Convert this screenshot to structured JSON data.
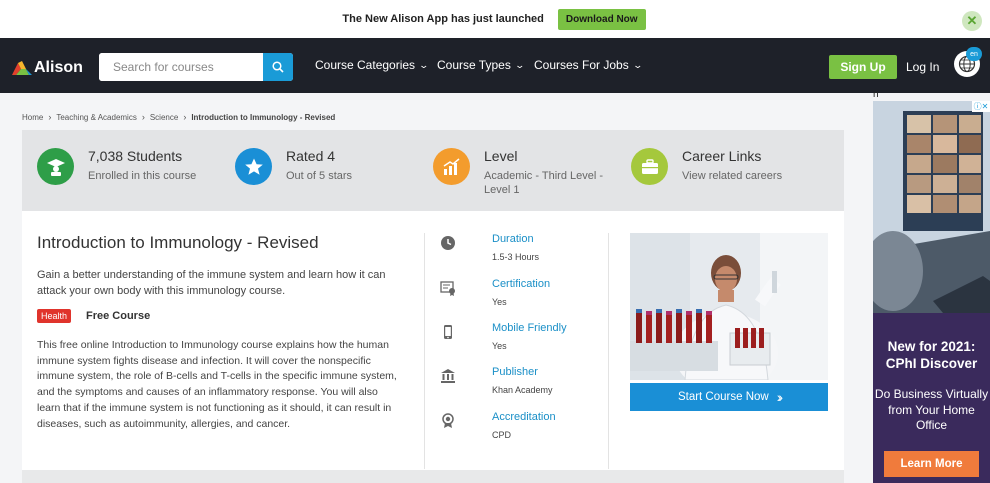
{
  "banner": {
    "text": "The New Alison App has just launched",
    "button": "Download Now"
  },
  "nav": {
    "logo": "Alison",
    "search_placeholder": "Search for courses",
    "links": [
      "Course Categories",
      "Course Types",
      "Courses For Jobs"
    ],
    "signup": "Sign Up",
    "login": "Log In",
    "lang": "en"
  },
  "breadcrumb": [
    "Home",
    "Teaching & Academics",
    "Science",
    "Introduction to Immunology - Revised"
  ],
  "stats": [
    {
      "title": "7,038 Students",
      "sub": "Enrolled in this course",
      "icon": "graduate-icon",
      "color": "#2e9e48"
    },
    {
      "title": "Rated 4",
      "sub": "Out of 5 stars",
      "icon": "star-icon",
      "color": "#1a8fd6"
    },
    {
      "title": "Level",
      "sub": "Academic - Third Level - Level 1",
      "icon": "level-chart-icon",
      "color": "#f39c2d"
    },
    {
      "title": "Career Links",
      "sub": "View related careers",
      "icon": "briefcase-icon",
      "color": "#a5c83c"
    }
  ],
  "course": {
    "title": "Introduction to Immunology - Revised",
    "subtitle": "Gain a better understanding of the immune system and learn how it can attack your own body with this immunology course.",
    "tag": "Health",
    "price": "Free Course",
    "description": "This free online Introduction to Immunology course explains how the human immune system fights disease and infection. It will cover the nonspecific immune system, the role of B-cells and T-cells in the specific immune system, and the symptoms and causes of an inflammatory response. You will also learn that if the immune system is not functioning as it should, it can result in diseases, such as autoimmunity, allergies, and cancer.",
    "start_button": "Start Course Now"
  },
  "meta": [
    {
      "label": "Duration",
      "value": "1.5-3 Hours",
      "icon": "clock-icon"
    },
    {
      "label": "Certification",
      "value": "Yes",
      "icon": "certificate-icon"
    },
    {
      "label": "Mobile Friendly",
      "value": "Yes",
      "icon": "mobile-icon"
    },
    {
      "label": "Publisher",
      "value": "Khan Academy",
      "icon": "institution-icon"
    },
    {
      "label": "Accreditation",
      "value": "CPD",
      "icon": "badge-icon"
    }
  ],
  "ad": {
    "stray_text": "n",
    "headline": "New for 2021: CPhI Discover",
    "body": "Do Business Virtually from Your Home Office",
    "button": "Learn More"
  }
}
